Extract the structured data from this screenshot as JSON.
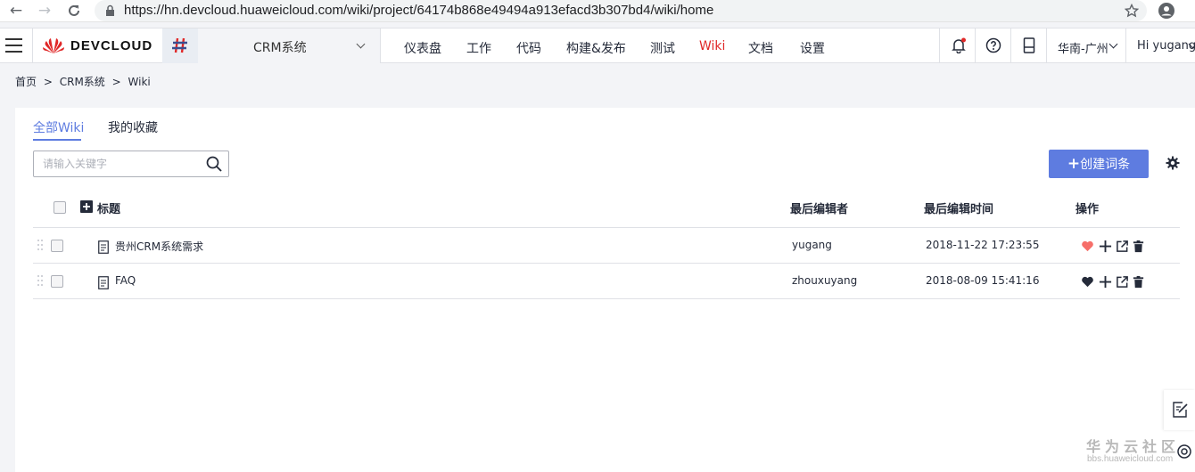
{
  "browser": {
    "url": "https://hn.devcloud.huaweicloud.com/wiki/project/64174b868e49494a913efacd3b307bd4/wiki/home"
  },
  "header": {
    "logo": "DEVCLOUD",
    "project_name": "CRM系统",
    "nav": [
      {
        "label": "仪表盘"
      },
      {
        "label": "工作"
      },
      {
        "label": "代码"
      },
      {
        "label": "构建&发布"
      },
      {
        "label": "测试"
      },
      {
        "label": "Wiki"
      },
      {
        "label": "文档"
      },
      {
        "label": "设置"
      }
    ],
    "region": "华南-广州",
    "greeting": "Hi yugang"
  },
  "breadcrumb": {
    "items": [
      "首页",
      ">",
      "CRM系统",
      ">",
      "Wiki"
    ]
  },
  "tabs": [
    {
      "label": "全部Wiki"
    },
    {
      "label": "我的收藏"
    }
  ],
  "search": {
    "placeholder": "请输入关键字"
  },
  "toolbar": {
    "create_label": "创建词条"
  },
  "table": {
    "headers": {
      "title": "标题",
      "editor": "最后编辑者",
      "time": "最后编辑时间",
      "actions": "操作"
    },
    "rows": [
      {
        "title": "贵州CRM系统需求",
        "editor": "yugang",
        "time": "2018-11-22 17:23:55",
        "favorited": true
      },
      {
        "title": "FAQ",
        "editor": "zhouxuyang",
        "time": "2018-08-09 15:41:16",
        "favorited": false
      }
    ]
  },
  "watermark": {
    "title": "华为云社区",
    "url": "bbs.huaweicloud.com"
  },
  "colors": {
    "accent": "#5e7ce0",
    "active_nav": "#e02828",
    "favorite": "#f66f6a"
  }
}
